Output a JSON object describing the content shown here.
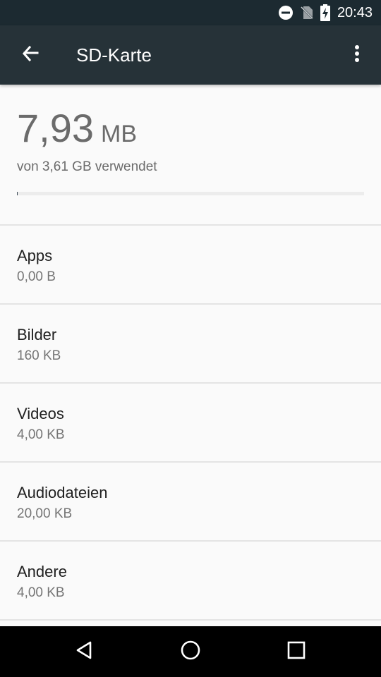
{
  "status_bar": {
    "time": "20:43",
    "icons": [
      "do-not-disturb-icon",
      "no-sim-icon",
      "battery-charging-icon"
    ]
  },
  "app_bar": {
    "title": "SD-Karte",
    "back_icon": "arrow-back-icon",
    "menu_icon": "more-vert-icon"
  },
  "summary": {
    "used_value": "7,93",
    "used_unit": "MB",
    "caption": "von 3,61 GB verwendet",
    "used_fraction": 0.0021
  },
  "categories": [
    {
      "label": "Apps",
      "size": "0,00 B"
    },
    {
      "label": "Bilder",
      "size": "160 KB"
    },
    {
      "label": "Videos",
      "size": "4,00 KB"
    },
    {
      "label": "Audiodateien",
      "size": "20,00 KB"
    },
    {
      "label": "Andere",
      "size": "4,00 KB"
    }
  ],
  "nav_bar": {
    "back": "triangle-back-icon",
    "home": "circle-home-icon",
    "recents": "square-recents-icon"
  }
}
